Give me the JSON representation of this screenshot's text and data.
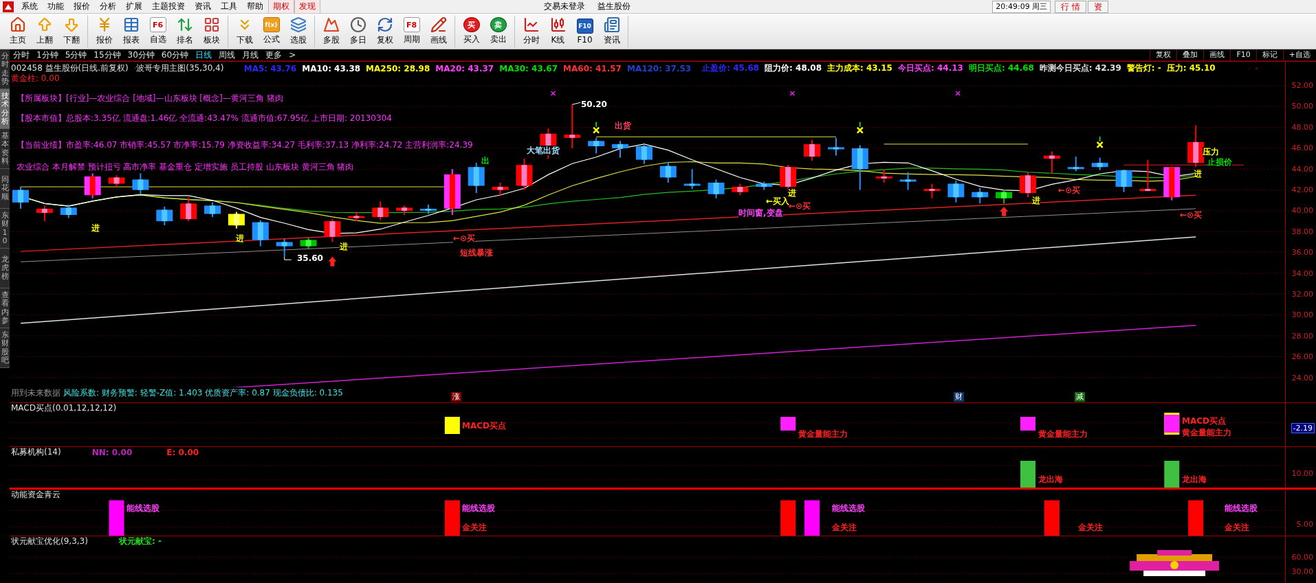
{
  "menu_bar": {
    "items": [
      "系统",
      "功能",
      "报价",
      "分析",
      "扩展",
      "主题投资",
      "资讯",
      "工具",
      "帮助"
    ],
    "special_items": [
      "期权",
      "发现"
    ],
    "trade_status": "交易未登录",
    "stock_name": "益生股份",
    "clock": "20:49:09 周三",
    "tabs": [
      "行 情",
      "资"
    ]
  },
  "toolbar": {
    "groups": [
      [
        {
          "label": "主页"
        },
        {
          "label": "上翻"
        },
        {
          "label": "下翻"
        }
      ],
      [
        {
          "label": "报价"
        },
        {
          "label": "报表"
        },
        {
          "label": "自选",
          "badge": "F6"
        },
        {
          "label": "排名"
        },
        {
          "label": "板块"
        }
      ],
      [
        {
          "label": "下载"
        },
        {
          "label": "公式",
          "badge": "f(x)"
        },
        {
          "label": "选股"
        }
      ],
      [
        {
          "label": "多股"
        },
        {
          "label": "多日"
        },
        {
          "label": "复权"
        },
        {
          "label": "周期",
          "badge": "F8"
        },
        {
          "label": "画线"
        }
      ],
      [
        {
          "label": "买入",
          "badge": "买"
        },
        {
          "label": "卖出",
          "badge": "卖"
        }
      ],
      [
        {
          "label": "分时"
        },
        {
          "label": "K线"
        },
        {
          "label": "F10",
          "badge": "F10"
        },
        {
          "label": "资讯"
        }
      ]
    ]
  },
  "side_tabs": [
    {
      "label": "分时走势",
      "selected": false
    },
    {
      "label": "技术分析",
      "selected": true
    },
    {
      "label": "基本资料",
      "selected": false
    },
    {
      "label": "同花顺",
      "selected": false
    },
    {
      "label": "东财10",
      "selected": false
    },
    {
      "label": "龙虎榜",
      "selected": false
    },
    {
      "label": "查看内参",
      "selected": false
    },
    {
      "label": "东财股吧",
      "selected": false
    }
  ],
  "period_bar": {
    "periods": [
      {
        "label": "分时",
        "selected": false
      },
      {
        "label": "1分钟",
        "selected": false
      },
      {
        "label": "5分钟",
        "selected": false
      },
      {
        "label": "15分钟",
        "selected": false
      },
      {
        "label": "30分钟",
        "selected": false
      },
      {
        "label": "60分钟",
        "selected": false
      },
      {
        "label": "日线",
        "selected": true
      },
      {
        "label": "周线",
        "selected": false
      },
      {
        "label": "月线",
        "selected": false
      }
    ],
    "more": "更多",
    "more_arrow": ">",
    "tools": [
      "复权",
      "叠加",
      "画线",
      "F10",
      "标记",
      "+自选"
    ]
  },
  "main_chart": {
    "title": "002458 益生股份(日线.前复权)",
    "formula": "波哥专用主图(35,30,4)",
    "ma_values": [
      {
        "text": "MA5: 43.76",
        "color": "#2828ff"
      },
      {
        "text": "MA10: 43.38",
        "color": "#ffffff"
      },
      {
        "text": "MA250: 28.98",
        "color": "#ffff00"
      },
      {
        "text": "MA20: 43.37",
        "color": "#ff40ff"
      },
      {
        "text": "MA30: 43.67",
        "color": "#00e000"
      },
      {
        "text": "MA60: 41.57",
        "color": "#ff3030"
      },
      {
        "text": "MA120: 37.53",
        "color": "#2040d0"
      }
    ],
    "right_values": [
      {
        "text": "止盈价: 45.68",
        "color": "#2828ff"
      },
      {
        "text": "阻力价: 48.08",
        "color": "#ffffff"
      },
      {
        "text": "主力成本: 43.15",
        "color": "#ffff00"
      },
      {
        "text": "今日买点: 44.13",
        "color": "#ff40ff"
      },
      {
        "text": "明日买点: 44.68",
        "color": "#00e000"
      },
      {
        "text": "昨测今日买点: 42.39",
        "color": "#e0e0e0"
      },
      {
        "text": "警告灯: -",
        "color": "#ffff00"
      },
      {
        "text": "压力: 45.10",
        "color": "#ffff00"
      }
    ],
    "golden_bar": "黄金柱: 0.00",
    "info_lines": [
      "【所属板块】[行业]—农业综合 [地域]—山东板块 [概念]—黄河三角 猪肉",
      "【股本市值】总股本:3.35亿 流通盘:1.46亿 全流通:43.47% 流通市值:67.95亿 上市日期: 20130304",
      "【当前业绩】市盈率:46.07 市销率:45.57 市净率:15.79 净资收益率:34.27 毛利率:37.13 净利率:24.72 主营利润率:24.39"
    ],
    "concepts": "农业综合 本月解禁 预计扭亏 高市净率 基金重仓 定增实施 员工持股 山东板块 黄河三角 猪肉",
    "annotations": [
      {
        "text": "50.20",
        "color": "#ffffff"
      },
      {
        "text": "出货",
        "color": "#ff4060"
      },
      {
        "text": "大笔出货",
        "color": "#a0e0ff"
      },
      {
        "text": "出",
        "color": "#00e000"
      },
      {
        "text": "35.60",
        "color": "#ffffff"
      },
      {
        "text": "进",
        "color": "#ffff00"
      },
      {
        "text": "进",
        "color": "#ffff00"
      },
      {
        "text": "进",
        "color": "#ffff00"
      },
      {
        "text": "进",
        "color": "#ffff00"
      },
      {
        "text": "进",
        "color": "#ffff00"
      },
      {
        "text": "进",
        "color": "#ffff00"
      },
      {
        "text": "←⊙买",
        "color": "#ff3030"
      },
      {
        "text": "←⊙买",
        "color": "#ff3030"
      },
      {
        "text": "←⊙买",
        "color": "#ff3030"
      },
      {
        "text": "←⊙买",
        "color": "#ff3030"
      },
      {
        "text": "短线暴涨",
        "color": "#ff3030"
      },
      {
        "text": "←买入",
        "color": "#ffff00"
      },
      {
        "text": "时间窗,变盘",
        "color": "#ff40ff"
      },
      {
        "text": "压力",
        "color": "#ffff00"
      },
      {
        "text": "止损价",
        "color": "#00e000"
      }
    ],
    "y_ticks": [
      "52.00",
      "50.00",
      "48.00",
      "46.00",
      "44.00",
      "42.00",
      "40.00",
      "38.00",
      "36.00",
      "34.00",
      "32.00",
      "30.00",
      "28.00",
      "26.00",
      "24.00"
    ],
    "footer_note": "用到未来数据",
    "risk_line": "风险系数: 财务预警: 轻警-Z值: 1.403 优质资产率: 0.87 现金负债比: 0.135",
    "event_tags": [
      {
        "text": "涨",
        "color": "#800000"
      },
      {
        "text": "财",
        "color": "#103870"
      },
      {
        "text": "减",
        "color": "#107010"
      }
    ]
  },
  "panels": [
    {
      "kind": "macd",
      "title": "MACD买点(0.01,12,12,12)",
      "markers": [
        {
          "text": "MACD买点",
          "color": "#ff2020"
        },
        {
          "text": "黄金量能主力",
          "color": "#ff2020"
        },
        {
          "text": "黄金量能主力",
          "color": "#ff2020"
        },
        {
          "text": "MACD买点",
          "color": "#ff2020"
        },
        {
          "text": "黄金量能主力",
          "color": "#ff2020"
        }
      ],
      "axis_labels": [
        {
          "text": "-2.19",
          "highlighted": true
        }
      ]
    },
    {
      "kind": "private",
      "title": "私募机构(14)",
      "values": [
        {
          "text": "NN: 0.00",
          "color": "#c020c0"
        },
        {
          "text": "E: 0.00",
          "color": "#ff2020"
        }
      ],
      "markers": [
        {
          "text": "龙出海",
          "color": "#ff2020"
        },
        {
          "text": "龙出海",
          "color": "#ff2020"
        }
      ],
      "axis_labels": [
        {
          "text": "10.00",
          "highlighted": false
        }
      ]
    },
    {
      "kind": "momentum",
      "title": "动能资金青云",
      "markers": [
        {
          "text": "能线选股",
          "color": "#ff40ff"
        },
        {
          "text": "能线选股",
          "color": "#ff40ff"
        },
        {
          "text": "金关注",
          "color": "#ff2020"
        },
        {
          "text": "能线选股",
          "color": "#ff40ff"
        },
        {
          "text": "金关注",
          "color": "#ff2020"
        },
        {
          "text": "金关注",
          "color": "#ff2020"
        },
        {
          "text": "能线选股",
          "color": "#ff40ff"
        },
        {
          "text": "金关注",
          "color": "#ff2020"
        }
      ],
      "axis_labels": [
        {
          "text": "5.00",
          "highlighted": false
        }
      ]
    },
    {
      "kind": "treasure",
      "title": "状元献宝优化(9,3,3)",
      "values": [
        {
          "text": "状元献宝: -",
          "color": "#20e020"
        }
      ],
      "axis_labels": [
        {
          "text": "60.00",
          "highlighted": false
        },
        {
          "text": "30.00",
          "highlighted": false
        }
      ]
    }
  ]
}
